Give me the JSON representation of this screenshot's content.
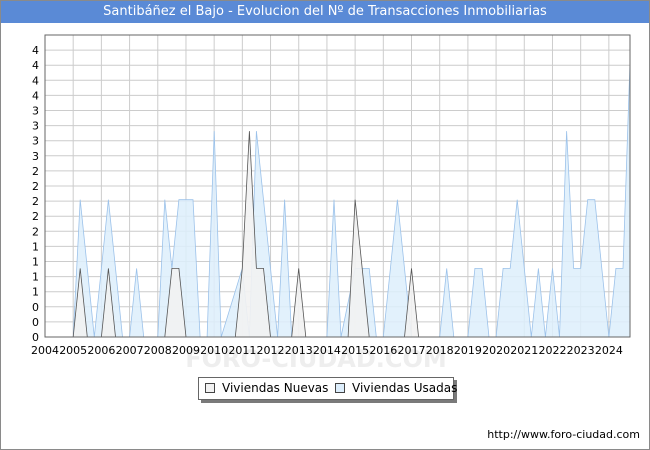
{
  "title": "Santibáñez el Bajo - Evolucion del Nº de Transacciones Inmobiliarias",
  "watermark": "FORO-CIUDAD.COM",
  "footer_url": "http://www.foro-ciudad.com",
  "colors": {
    "title_bg": "#5a8ad6",
    "nuevas_fill": "#f2f2f2",
    "nuevas_line": "#555555",
    "usadas_fill": "#ddeefc",
    "usadas_line": "#9cc2ea",
    "grid": "#cccccc"
  },
  "chart_data": {
    "type": "area",
    "title": "Santibáñez el Bajo - Evolucion del Nº de Transacciones Inmobiliarias",
    "xlabel": "",
    "ylabel": "",
    "x_ticks": [
      "2004",
      "2005",
      "2006",
      "2007",
      "2008",
      "2009",
      "2010",
      "2011",
      "2012",
      "2013",
      "2014",
      "2015",
      "2016",
      "2017",
      "2018",
      "2019",
      "2020",
      "2021",
      "2022",
      "2023",
      "2024"
    ],
    "y_tick_labels": [
      "0",
      "0",
      "0",
      "1",
      "1",
      "1",
      "1",
      "2",
      "2",
      "2",
      "2",
      "2",
      "3",
      "3",
      "3",
      "3",
      "4",
      "4",
      "4",
      "4"
    ],
    "ylim": [
      0,
      4.4
    ],
    "xlim": [
      2004,
      2024.75
    ],
    "grid": true,
    "legend_position": "bottom-center",
    "series": [
      {
        "name": "Viviendas Nuevas",
        "points": [
          [
            2005,
            0
          ],
          [
            2005.25,
            1
          ],
          [
            2005.5,
            0
          ],
          [
            2005.75,
            0
          ],
          [
            2006,
            0
          ],
          [
            2006.25,
            1
          ],
          [
            2006.5,
            0
          ],
          [
            2008.25,
            0
          ],
          [
            2008.5,
            1
          ],
          [
            2008.75,
            1
          ],
          [
            2009,
            0
          ],
          [
            2010.75,
            0
          ],
          [
            2011,
            1
          ],
          [
            2011.25,
            3
          ],
          [
            2011.5,
            1
          ],
          [
            2011.75,
            1
          ],
          [
            2012,
            0
          ],
          [
            2012.75,
            0
          ],
          [
            2013,
            1
          ],
          [
            2013.25,
            0
          ],
          [
            2014.75,
            0
          ],
          [
            2015,
            2
          ],
          [
            2015.25,
            1
          ],
          [
            2015.5,
            0
          ],
          [
            2016.75,
            0
          ],
          [
            2017,
            1
          ],
          [
            2017.25,
            0
          ]
        ]
      },
      {
        "name": "Viviendas Usadas",
        "points": [
          [
            2005,
            0
          ],
          [
            2005.25,
            2
          ],
          [
            2005.5,
            1
          ],
          [
            2005.75,
            0
          ],
          [
            2006,
            1
          ],
          [
            2006.25,
            2
          ],
          [
            2006.5,
            1
          ],
          [
            2006.75,
            0
          ],
          [
            2007,
            0
          ],
          [
            2007.25,
            1
          ],
          [
            2007.5,
            0
          ],
          [
            2008,
            0
          ],
          [
            2008.25,
            2
          ],
          [
            2008.5,
            1
          ],
          [
            2008.75,
            2
          ],
          [
            2009,
            2
          ],
          [
            2009.25,
            2
          ],
          [
            2009.5,
            0
          ],
          [
            2009.75,
            0
          ],
          [
            2010,
            3
          ],
          [
            2010.25,
            0
          ],
          [
            2011,
            1
          ],
          [
            2011.25,
            0
          ],
          [
            2011.5,
            3
          ],
          [
            2011.75,
            2
          ],
          [
            2012,
            1
          ],
          [
            2012.25,
            0
          ],
          [
            2012.5,
            2
          ],
          [
            2012.75,
            0
          ],
          [
            2013,
            0
          ],
          [
            2013.25,
            0
          ],
          [
            2013.5,
            0
          ],
          [
            2014,
            0
          ],
          [
            2014.25,
            2
          ],
          [
            2014.5,
            0
          ],
          [
            2015,
            1
          ],
          [
            2015.25,
            1
          ],
          [
            2015.5,
            1
          ],
          [
            2015.75,
            0
          ],
          [
            2016,
            0
          ],
          [
            2016.25,
            1
          ],
          [
            2016.5,
            2
          ],
          [
            2016.75,
            1
          ],
          [
            2017,
            0
          ],
          [
            2018,
            0
          ],
          [
            2018.25,
            1
          ],
          [
            2018.5,
            0
          ],
          [
            2019,
            0
          ],
          [
            2019.25,
            1
          ],
          [
            2019.5,
            1
          ],
          [
            2019.75,
            0
          ],
          [
            2020,
            0
          ],
          [
            2020.25,
            1
          ],
          [
            2020.5,
            1
          ],
          [
            2020.75,
            2
          ],
          [
            2021,
            1
          ],
          [
            2021.25,
            0
          ],
          [
            2021.5,
            1
          ],
          [
            2021.75,
            0
          ],
          [
            2022,
            1
          ],
          [
            2022.25,
            0
          ],
          [
            2022.5,
            3
          ],
          [
            2022.75,
            1
          ],
          [
            2023,
            1
          ],
          [
            2023.25,
            2
          ],
          [
            2023.5,
            2
          ],
          [
            2023.75,
            1
          ],
          [
            2024,
            0
          ],
          [
            2024.25,
            1
          ],
          [
            2024.5,
            1
          ],
          [
            2024.75,
            4
          ]
        ]
      }
    ]
  }
}
